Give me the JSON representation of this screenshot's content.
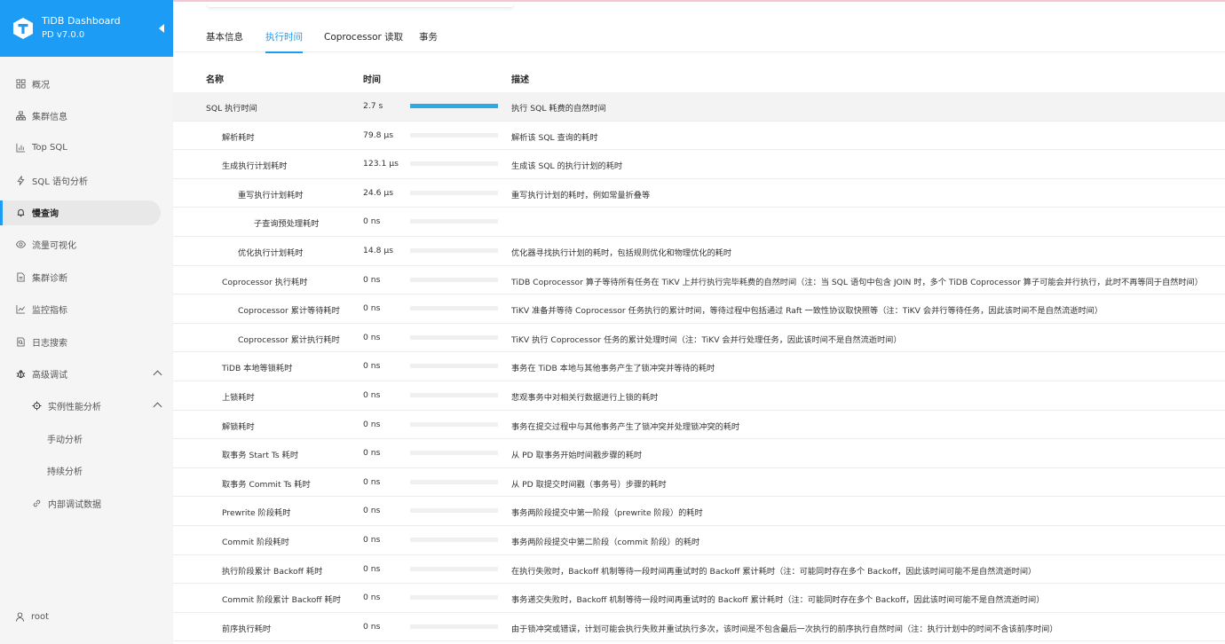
{
  "brand": {
    "title": "TiDB Dashboard",
    "version": "PD v7.0.0",
    "color": "#1c9cf4"
  },
  "sidebar": {
    "items": [
      {
        "label": "概况",
        "icon": "overview-icon"
      },
      {
        "label": "集群信息",
        "icon": "cluster-icon"
      },
      {
        "label": "Top SQL",
        "icon": "chart-bar-icon"
      },
      {
        "label": "SQL 语句分析",
        "icon": "lightning-icon"
      },
      {
        "label": "慢查询",
        "icon": "bell-icon",
        "active": true
      },
      {
        "label": "流量可视化",
        "icon": "eye-icon"
      },
      {
        "label": "集群诊断",
        "icon": "document-icon"
      },
      {
        "label": "监控指标",
        "icon": "line-chart-icon"
      },
      {
        "label": "日志搜索",
        "icon": "file-search-icon"
      },
      {
        "label": "高级调试",
        "icon": "bug-icon",
        "expanded": true
      },
      {
        "label": "实例性能分析",
        "icon": "aim-icon",
        "expanded": true
      },
      {
        "label": "手动分析"
      },
      {
        "label": "持续分析"
      },
      {
        "label": "内部调试数据",
        "icon": "link-icon"
      }
    ],
    "user": "root"
  },
  "tabs": [
    {
      "label": "基本信息"
    },
    {
      "label": "执行时间",
      "active": true
    },
    {
      "label": "Coprocessor 读取"
    },
    {
      "label": "事务"
    }
  ],
  "table": {
    "headers": {
      "name": "名称",
      "time": "时间",
      "desc": "描述"
    },
    "rows": [
      {
        "name": "SQL 执行时间",
        "time": "2.7 s",
        "ratio": 1.0,
        "desc": "执行 SQL 耗费的自然时间",
        "level": 0
      },
      {
        "name": "解析耗时",
        "time": "79.8 μs",
        "ratio": 0,
        "desc": "解析该 SQL 查询的耗时",
        "level": 1
      },
      {
        "name": "生成执行计划耗时",
        "time": "123.1 μs",
        "ratio": 0,
        "desc": "生成该 SQL 的执行计划的耗时",
        "level": 1
      },
      {
        "name": "重写执行计划耗时",
        "time": "24.6 μs",
        "ratio": 0,
        "desc": "重写执行计划的耗时，例如常量折叠等",
        "level": 2
      },
      {
        "name": "子查询预处理耗时",
        "time": "0 ns",
        "ratio": 0,
        "desc": "",
        "level": 3
      },
      {
        "name": "优化执行计划耗时",
        "time": "14.8 μs",
        "ratio": 0,
        "desc": "优化器寻找执行计划的耗时，包括规则优化和物理优化的耗时",
        "level": 2
      },
      {
        "name": "Coprocessor 执行耗时",
        "time": "0 ns",
        "ratio": 0,
        "desc": "TiDB Coprocessor 算子等待所有任务在 TiKV 上并行执行完毕耗费的自然时间（注：当 SQL 语句中包含 JOIN 时，多个 TiDB Coprocessor 算子可能会并行执行，此时不再等同于自然时间）",
        "level": 1
      },
      {
        "name": "Coprocessor 累计等待耗时",
        "time": "0 ns",
        "ratio": 0,
        "desc": "TiKV 准备并等待 Coprocessor 任务执行的累计时间，等待过程中包括通过 Raft 一致性协议取快照等（注：TiKV 会并行等待任务，因此该时间不是自然流逝时间）",
        "level": 2
      },
      {
        "name": "Coprocessor 累计执行耗时",
        "time": "0 ns",
        "ratio": 0,
        "desc": "TiKV 执行 Coprocessor 任务的累计处理时间（注：TiKV 会并行处理任务，因此该时间不是自然流逝时间）",
        "level": 2
      },
      {
        "name": "TiDB 本地等锁耗时",
        "time": "0 ns",
        "ratio": 0,
        "desc": "事务在 TiDB 本地与其他事务产生了锁冲突并等待的耗时",
        "level": 1
      },
      {
        "name": "上锁耗时",
        "time": "0 ns",
        "ratio": 0,
        "desc": "悲观事务中对相关行数据进行上锁的耗时",
        "level": 1
      },
      {
        "name": "解锁耗时",
        "time": "0 ns",
        "ratio": 0,
        "desc": "事务在提交过程中与其他事务产生了锁冲突并处理锁冲突的耗时",
        "level": 1
      },
      {
        "name": "取事务 Start Ts 耗时",
        "time": "0 ns",
        "ratio": 0,
        "desc": "从 PD 取事务开始时间戳步骤的耗时",
        "level": 1
      },
      {
        "name": "取事务 Commit Ts 耗时",
        "time": "0 ns",
        "ratio": 0,
        "desc": "从 PD 取提交时间戳（事务号）步骤的耗时",
        "level": 1
      },
      {
        "name": "Prewrite 阶段耗时",
        "time": "0 ns",
        "ratio": 0,
        "desc": "事务两阶段提交中第一阶段（prewrite 阶段）的耗时",
        "level": 1
      },
      {
        "name": "Commit 阶段耗时",
        "time": "0 ns",
        "ratio": 0,
        "desc": "事务两阶段提交中第二阶段（commit 阶段）的耗时",
        "level": 1
      },
      {
        "name": "执行阶段累计 Backoff 耗时",
        "time": "0 ns",
        "ratio": 0,
        "desc": "在执行失败时，Backoff 机制等待一段时间再重试时的 Backoff 累计耗时（注：可能同时存在多个 Backoff，因此该时间可能不是自然流逝时间）",
        "level": 1
      },
      {
        "name": "Commit 阶段累计 Backoff 耗时",
        "time": "0 ns",
        "ratio": 0,
        "desc": "事务递交失败时，Backoff 机制等待一段时间再重试时的 Backoff 累计耗时（注：可能同时存在多个 Backoff，因此该时间可能不是自然流逝时间）",
        "level": 1
      },
      {
        "name": "前序执行耗时",
        "time": "0 ns",
        "ratio": 0,
        "desc": "由于锁冲突或错误，计划可能会执行失败并重试执行多次，该时间是不包含最后一次执行的前序执行自然时间（注：执行计划中的时间不含该前序时间）",
        "level": 1
      }
    ]
  }
}
